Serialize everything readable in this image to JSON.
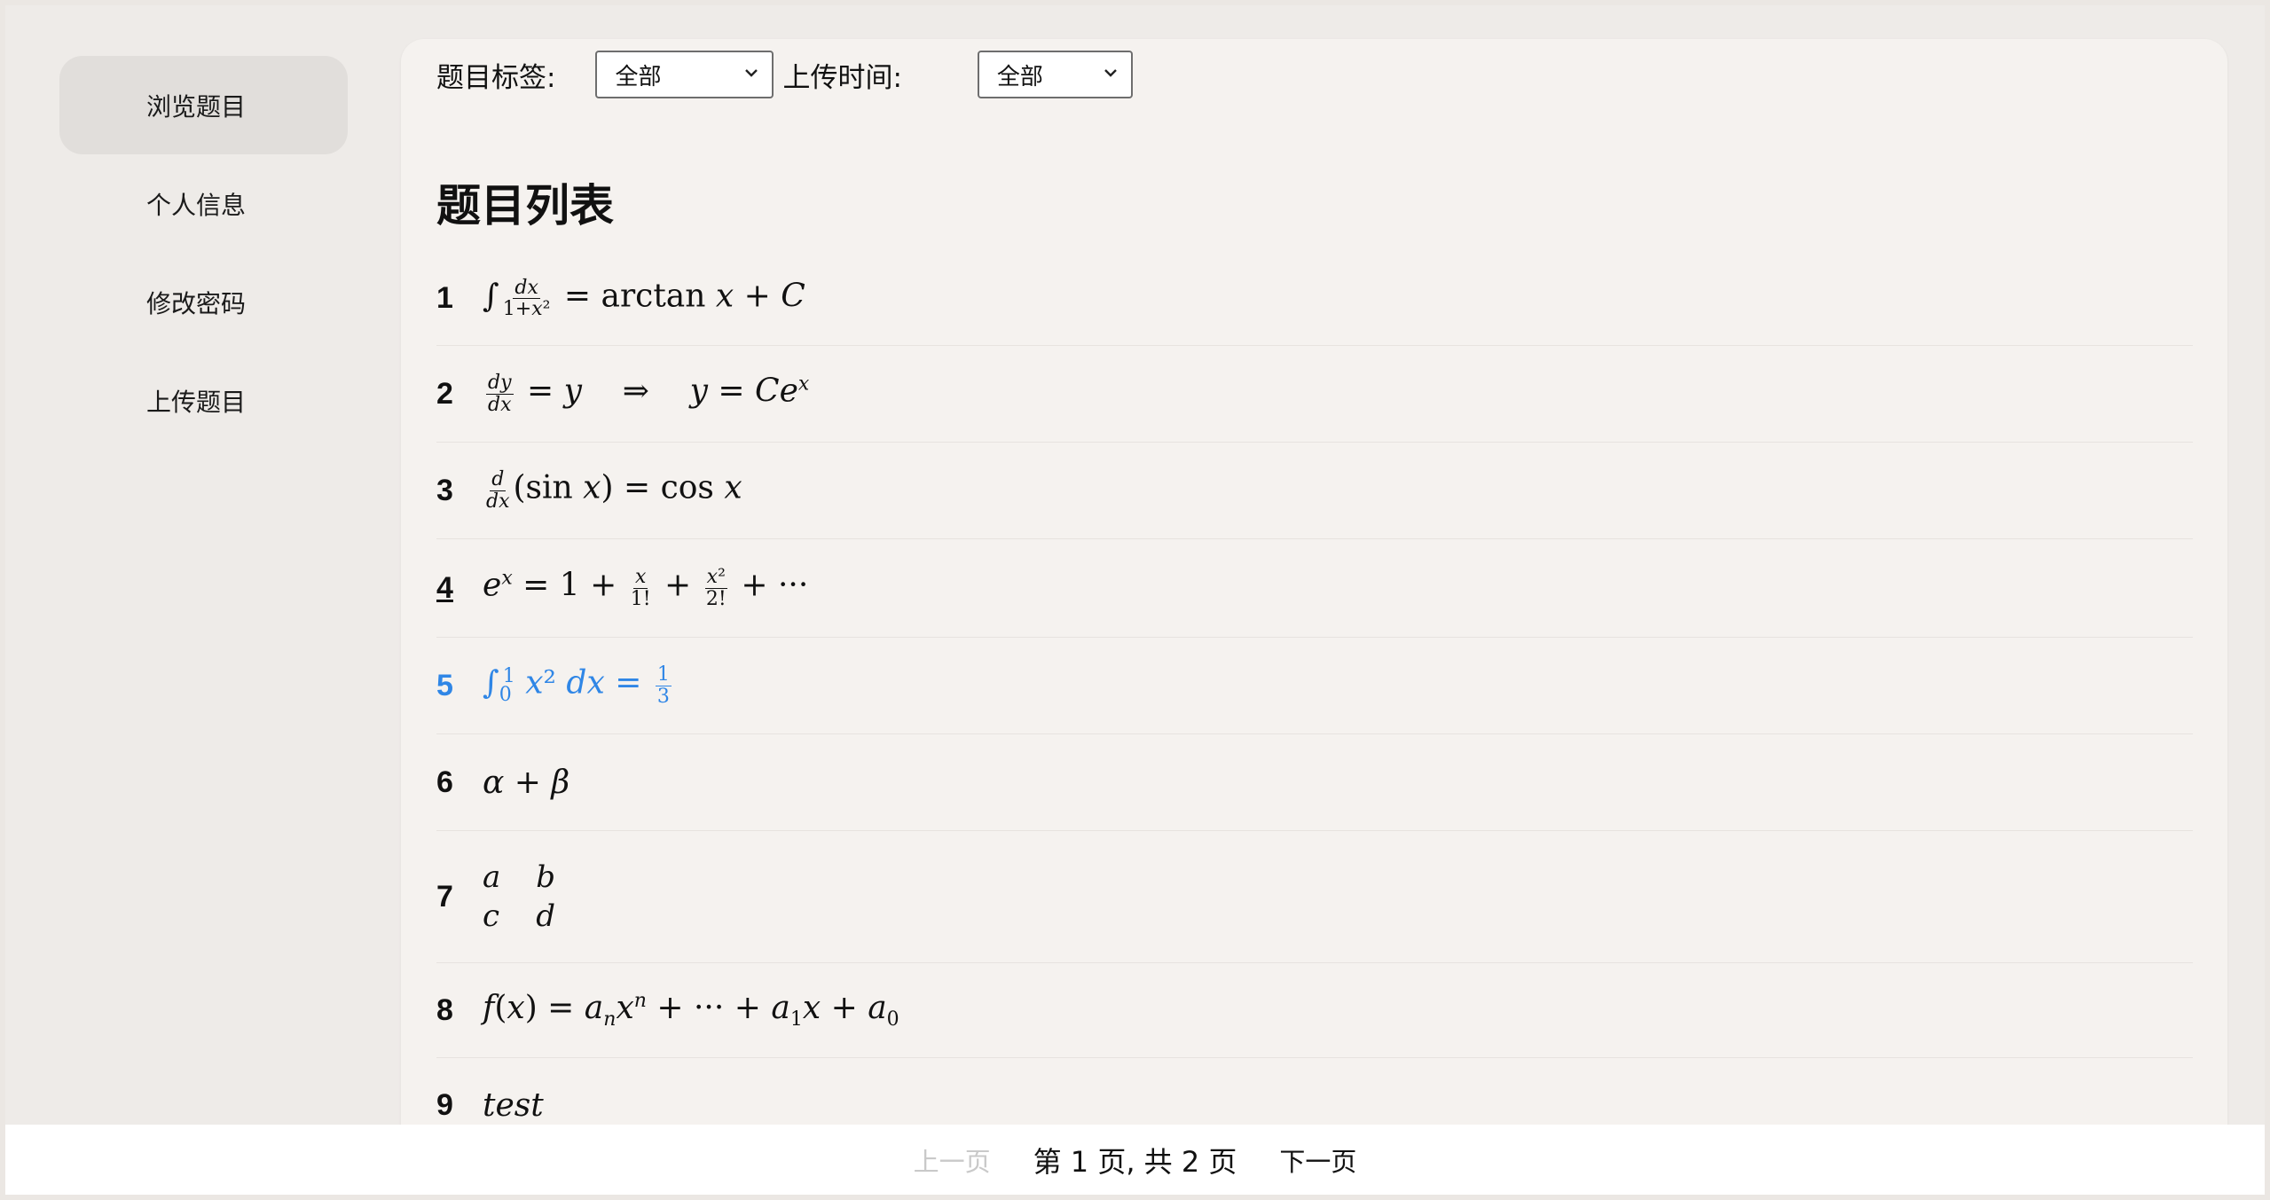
{
  "sidebar": {
    "items": [
      {
        "label": "浏览题目",
        "active": true
      },
      {
        "label": "个人信息",
        "active": false
      },
      {
        "label": "修改密码",
        "active": false
      },
      {
        "label": "上传题目",
        "active": false
      }
    ]
  },
  "filters": {
    "tag_label": "题目标签:",
    "tag_value": "全部",
    "time_label": "上传时间:",
    "time_value": "全部"
  },
  "list": {
    "title": "题目列表",
    "items": [
      {
        "num": "1"
      },
      {
        "num": "2"
      },
      {
        "num": "3"
      },
      {
        "num": "4"
      },
      {
        "num": "5"
      },
      {
        "num": "6"
      },
      {
        "num": "7"
      },
      {
        "num": "8"
      },
      {
        "num": "9"
      }
    ]
  },
  "pager": {
    "prev": "上一页",
    "status": "第 1 页, 共 2 页",
    "next": "下一页"
  },
  "colors": {
    "highlight": "#2f86e6",
    "active_nav_bg": "#e1dedb",
    "card_bg": "#f5f2ef",
    "page_bg": "#eeebe8"
  }
}
